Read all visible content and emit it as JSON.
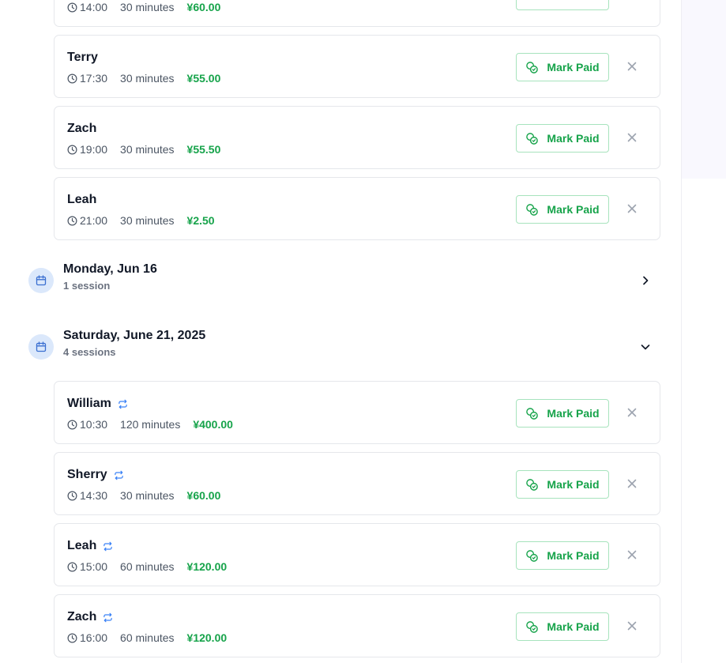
{
  "groups": [
    {
      "title": "Monday, Jun 16",
      "subtitle": "1 session",
      "expanded": false
    },
    {
      "title": "Saturday, June 21, 2025",
      "subtitle": "4 sessions",
      "expanded": true
    }
  ],
  "sessions_top": [
    {
      "name": "",
      "time": "14:00",
      "duration": "30 minutes",
      "price": "¥60.00",
      "recurring": false
    },
    {
      "name": "Terry",
      "time": "17:30",
      "duration": "30 minutes",
      "price": "¥55.00",
      "recurring": false
    },
    {
      "name": "Zach",
      "time": "19:00",
      "duration": "30 minutes",
      "price": "¥55.50",
      "recurring": false
    },
    {
      "name": "Leah",
      "time": "21:00",
      "duration": "30 minutes",
      "price": "¥2.50",
      "recurring": false
    }
  ],
  "sessions_saturday": [
    {
      "name": "William",
      "time": "10:30",
      "duration": "120 minutes",
      "price": "¥400.00",
      "recurring": true
    },
    {
      "name": "Sherry",
      "time": "14:30",
      "duration": "30 minutes",
      "price": "¥60.00",
      "recurring": true
    },
    {
      "name": "Leah",
      "time": "15:00",
      "duration": "60 minutes",
      "price": "¥120.00",
      "recurring": true
    },
    {
      "name": "Zach",
      "time": "16:00",
      "duration": "60 minutes",
      "price": "¥120.00",
      "recurring": true
    }
  ],
  "actions": {
    "mark_paid_label": "Mark Paid"
  },
  "icons": {
    "clock": "clock-icon",
    "coins": "coins-icon",
    "close": "close-icon",
    "calendar": "calendar-icon",
    "repeat": "repeat-icon",
    "chevron_right": "chevron-right-icon",
    "chevron_down": "chevron-down-icon"
  },
  "colors": {
    "accent_green": "#16a34a",
    "recurring_blue": "#3b82f6",
    "calendar_bg": "#dbe8fb",
    "calendar_fg": "#3b6fd1"
  }
}
